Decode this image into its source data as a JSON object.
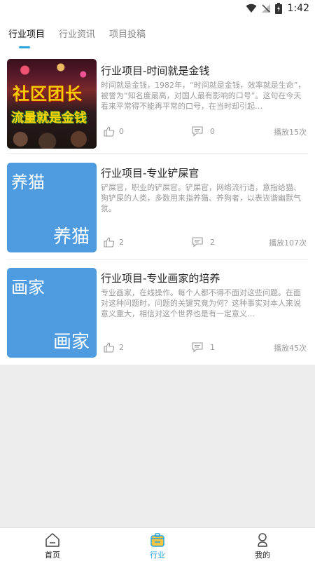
{
  "status": {
    "time": "1:42"
  },
  "tabs": [
    {
      "label": "行业项目",
      "active": true
    },
    {
      "label": "行业资讯",
      "active": false
    },
    {
      "label": "项目投稿",
      "active": false
    }
  ],
  "items": [
    {
      "title": "行业项目-时间就是金钱",
      "desc": "时间就是金钱，1982年，“时间就是金钱，效率就是生命”，被誉为“知名度最高，对国人最有影响的口号”。这句在今天看来平常得不能再平常的口号，在当时却引起…",
      "thumb_text1": "社区团长",
      "thumb_text2": "流量就是金钱",
      "likes": "0",
      "comments": "0",
      "plays": "播放15次"
    },
    {
      "title": "行业项目-专业铲屎官",
      "desc": "铲屎官，职业的铲屎官。铲屎官，网络流行语，意指给猫、狗铲屎的人类，多数用来指养猫、养狗者，以表诙谐幽默气氛。",
      "thumb_top": "养猫",
      "thumb_bottom": "养猫",
      "likes": "2",
      "comments": "2",
      "plays": "播放107次"
    },
    {
      "title": "行业项目-专业画家的培养",
      "desc": "专业画家，在线操作。每个人都不得不面对这些问题。在面对这种问题时，问题的关键究竟为何？这种事实对本人来说意义重大，相信对这个世界也是有一定意义…",
      "thumb_top": "画家",
      "thumb_bottom": "画家",
      "likes": "2",
      "comments": "1",
      "plays": "播放45次"
    }
  ],
  "nav": [
    {
      "label": "首页",
      "icon": "home-icon",
      "active": false
    },
    {
      "label": "行业",
      "icon": "industry-icon",
      "active": true
    },
    {
      "label": "我的",
      "icon": "profile-icon",
      "active": false
    }
  ],
  "colors": {
    "accent": "#2aa5df",
    "thumb_blue": "#4f9be0"
  }
}
